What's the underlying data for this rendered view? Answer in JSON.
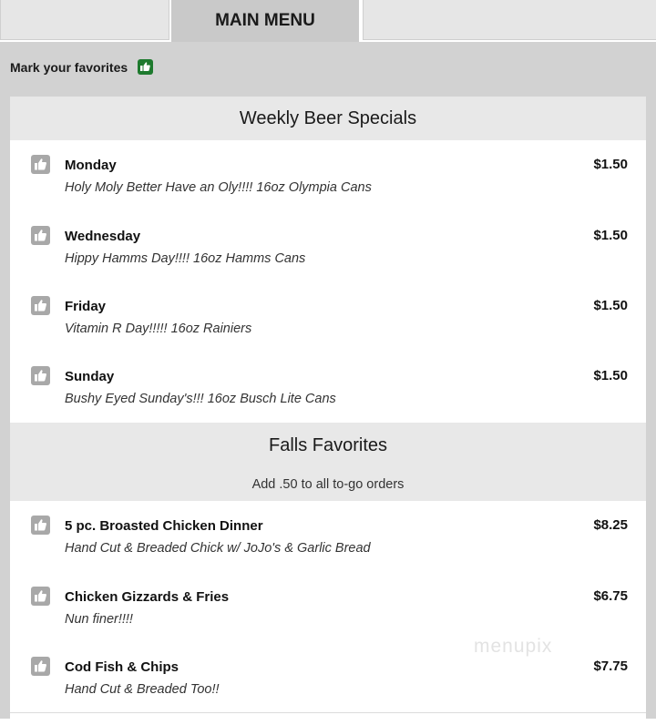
{
  "tabs": {
    "active_label": "MAIN MENU"
  },
  "favorites": {
    "label": "Mark your favorites",
    "icon": "thumbs-up-icon"
  },
  "sections": [
    {
      "title": "Weekly Beer Specials",
      "items": [
        {
          "name": "Monday",
          "desc": "Holy Moly Better Have an Oly!!!! 16oz Olympia Cans",
          "price": "$1.50"
        },
        {
          "name": "Wednesday",
          "desc": "Hippy Hamms Day!!!! 16oz Hamms Cans",
          "price": "$1.50"
        },
        {
          "name": "Friday",
          "desc": "Vitamin R Day!!!!! 16oz Rainiers",
          "price": "$1.50"
        },
        {
          "name": "Sunday",
          "desc": "Bushy Eyed Sunday's!!! 16oz Busch Lite Cans",
          "price": "$1.50"
        }
      ]
    },
    {
      "title": "Falls Favorites",
      "note": "Add .50 to all to-go orders",
      "items": [
        {
          "name": "5 pc. Broasted Chicken Dinner",
          "desc": "Hand Cut & Breaded Chick w/ JoJo's & Garlic Bread",
          "price": "$8.25"
        },
        {
          "name": "Chicken Gizzards & Fries",
          "desc": "Nun finer!!!!",
          "price": "$6.75"
        },
        {
          "name": "Cod Fish & Chips",
          "desc": "Hand Cut & Breaded Too!!",
          "price": "$7.75"
        }
      ]
    }
  ],
  "watermark": "menupix",
  "colors": {
    "accent_green": "#1e7a2e",
    "section_bg": "#e8e8e8",
    "tab_active": "#c9c9c9"
  }
}
